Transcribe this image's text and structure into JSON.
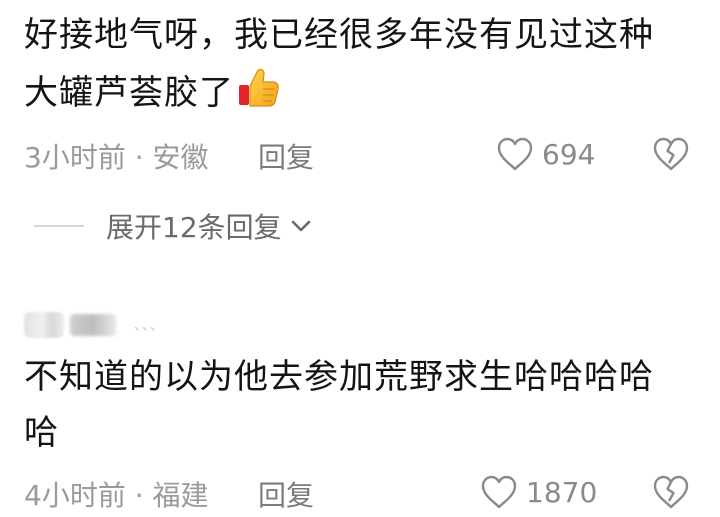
{
  "comments": [
    {
      "text_line1": "好接地气呀，我已经很多年没有见过这种",
      "text_line2": "大罐芦荟胶了",
      "emoji": "thumbs-up",
      "time": "3小时前",
      "location": "安徽",
      "time_location": "3小时前 · 安徽",
      "reply_label": "回复",
      "likes": "694"
    },
    {
      "username_obscured": true,
      "username_trailing": "、、、",
      "text_line1": "不知道的以为他去参加荒野求生哈哈哈哈",
      "text_line2": "哈",
      "time": "4小时前",
      "location": "福建",
      "time_location": "4小时前 · 福建",
      "reply_label": "回复",
      "likes": "1870"
    }
  ],
  "expand_replies": {
    "label": "展开12条回复"
  },
  "colors": {
    "text": "#141414",
    "meta": "#9a9a9a",
    "icon": "#8a8a8a",
    "background": "#ffffff"
  }
}
